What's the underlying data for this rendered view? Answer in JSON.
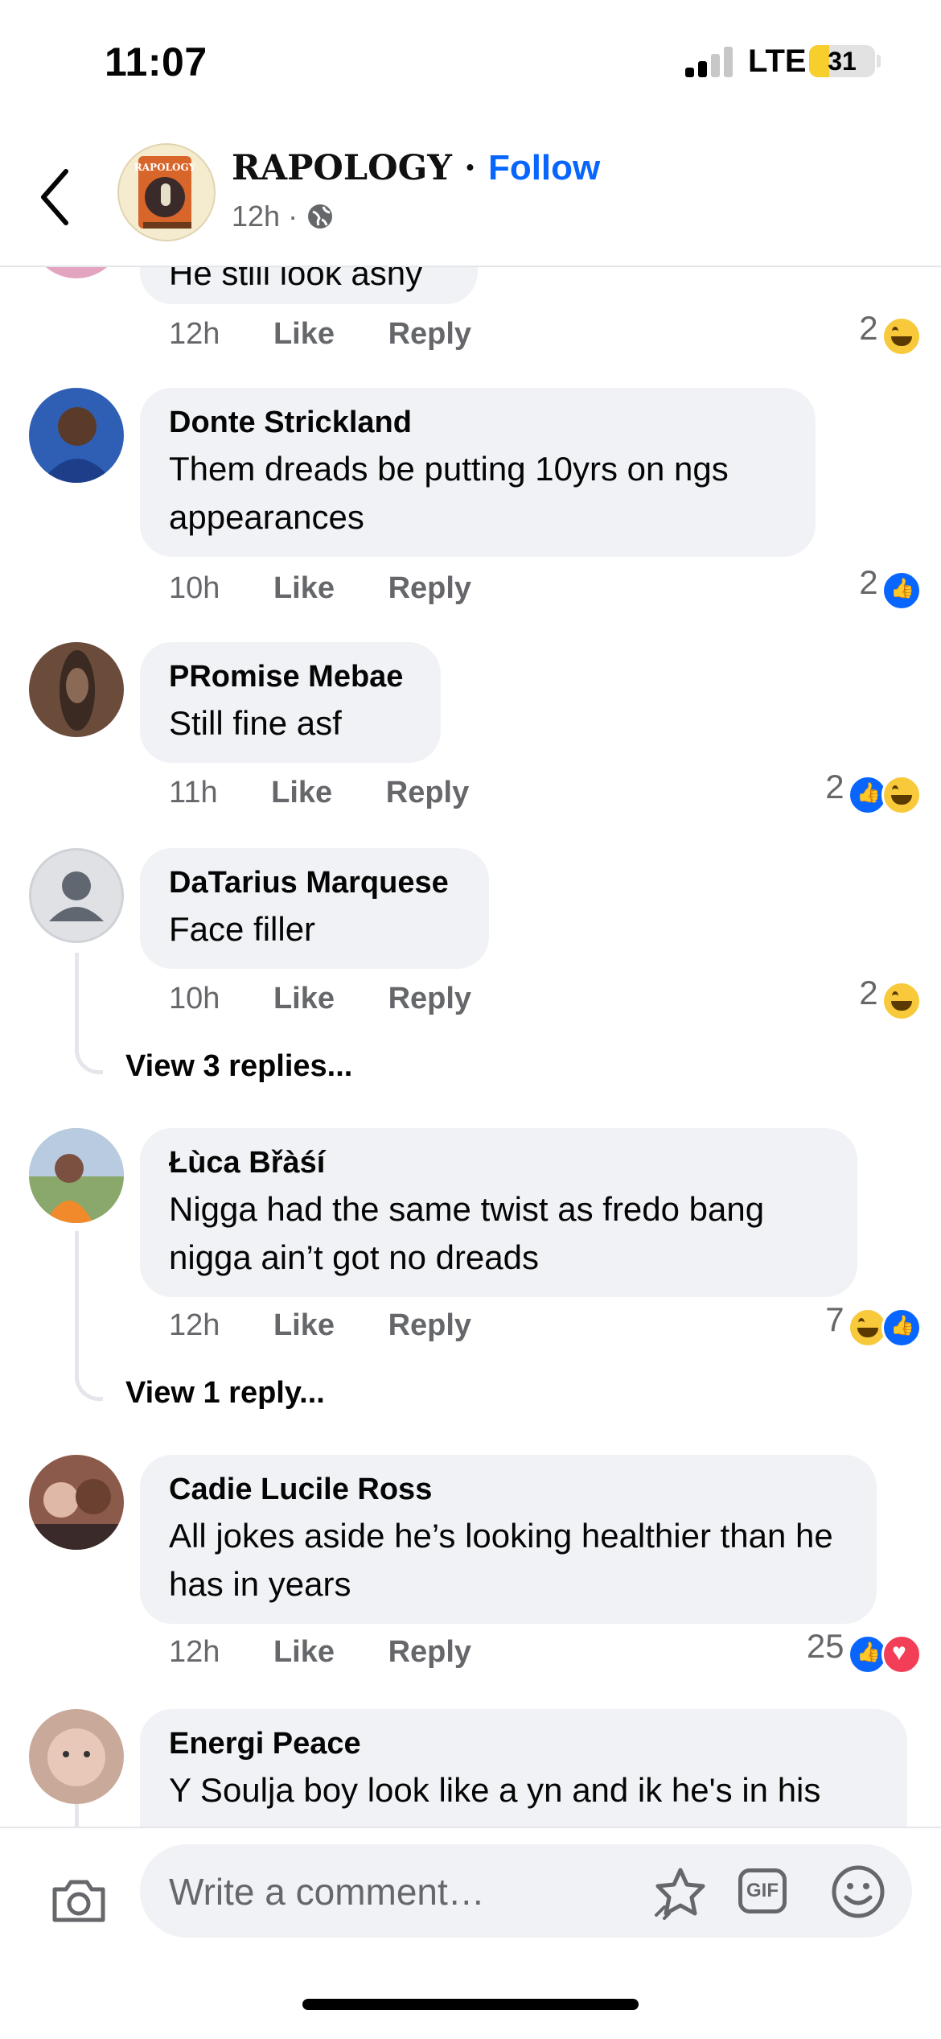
{
  "status_bar": {
    "time": "11:07",
    "network": "LTE",
    "battery": "31"
  },
  "header": {
    "page_name": "RAPOLOGY",
    "separator": "·",
    "follow_label": "Follow",
    "time": "12h",
    "dot": "·",
    "logo_text": "RAPOLOGY",
    "icons": [
      "back-icon",
      "globe-icon",
      "more-icon"
    ]
  },
  "partial_comment": {
    "text": "He still look ashy",
    "time": "12h",
    "like": "Like",
    "reply": "Reply",
    "reaction_count": "2",
    "reactions": [
      "haha"
    ]
  },
  "comments": [
    {
      "name": "Donte Strickland",
      "text": "Them dreads be putting 10yrs on ngs appearances",
      "time": "10h",
      "like": "Like",
      "reply": "Reply",
      "reaction_count": "2",
      "reactions": [
        "like"
      ],
      "avatar_color": "#2f5fb5"
    },
    {
      "name": "PRomise Mebae",
      "text": "Still fine asf",
      "time": "11h",
      "like": "Like",
      "reply": "Reply",
      "reaction_count": "2",
      "reactions": [
        "like",
        "haha"
      ],
      "avatar_color": "#6b4c3b"
    },
    {
      "name": "DaTarius Marquese",
      "text": "Face filler",
      "time": "10h",
      "like": "Like",
      "reply": "Reply",
      "reaction_count": "2",
      "reactions": [
        "haha"
      ],
      "view_replies": "View 3 replies...",
      "avatar_color": "#dfe1e5"
    },
    {
      "name": "Łùca Břàśí",
      "text": "Nigga had the same twist as fredo bang nigga ain’t got no dreads",
      "time": "12h",
      "like": "Like",
      "reply": "Reply",
      "reaction_count": "7",
      "reactions": [
        "haha",
        "like"
      ],
      "view_replies": "View 1 reply...",
      "avatar_color": "#8aa86b"
    },
    {
      "name": "Cadie Lucile Ross",
      "text": "All jokes aside he’s looking healthier than he has in years",
      "time": "12h",
      "like": "Like",
      "reply": "Reply",
      "reaction_count": "25",
      "reactions": [
        "like",
        "love"
      ],
      "avatar_color": "#8c5a4a"
    },
    {
      "name": "Energi Peace",
      "text": "Y Soulja boy look like a yn and ik he's in his",
      "avatar_color": "#c9a99a"
    }
  ],
  "composer": {
    "placeholder": "Write a comment…",
    "gif_label": "GIF",
    "icons": [
      "camera-icon",
      "avatar-sticker-icon",
      "gif-icon",
      "emoji-icon"
    ]
  },
  "colors": {
    "accent": "#0866ff",
    "bubble": "#f0f2f5",
    "secondary_text": "#65676b",
    "haha": "#f8c93a",
    "love": "#f33e58"
  }
}
